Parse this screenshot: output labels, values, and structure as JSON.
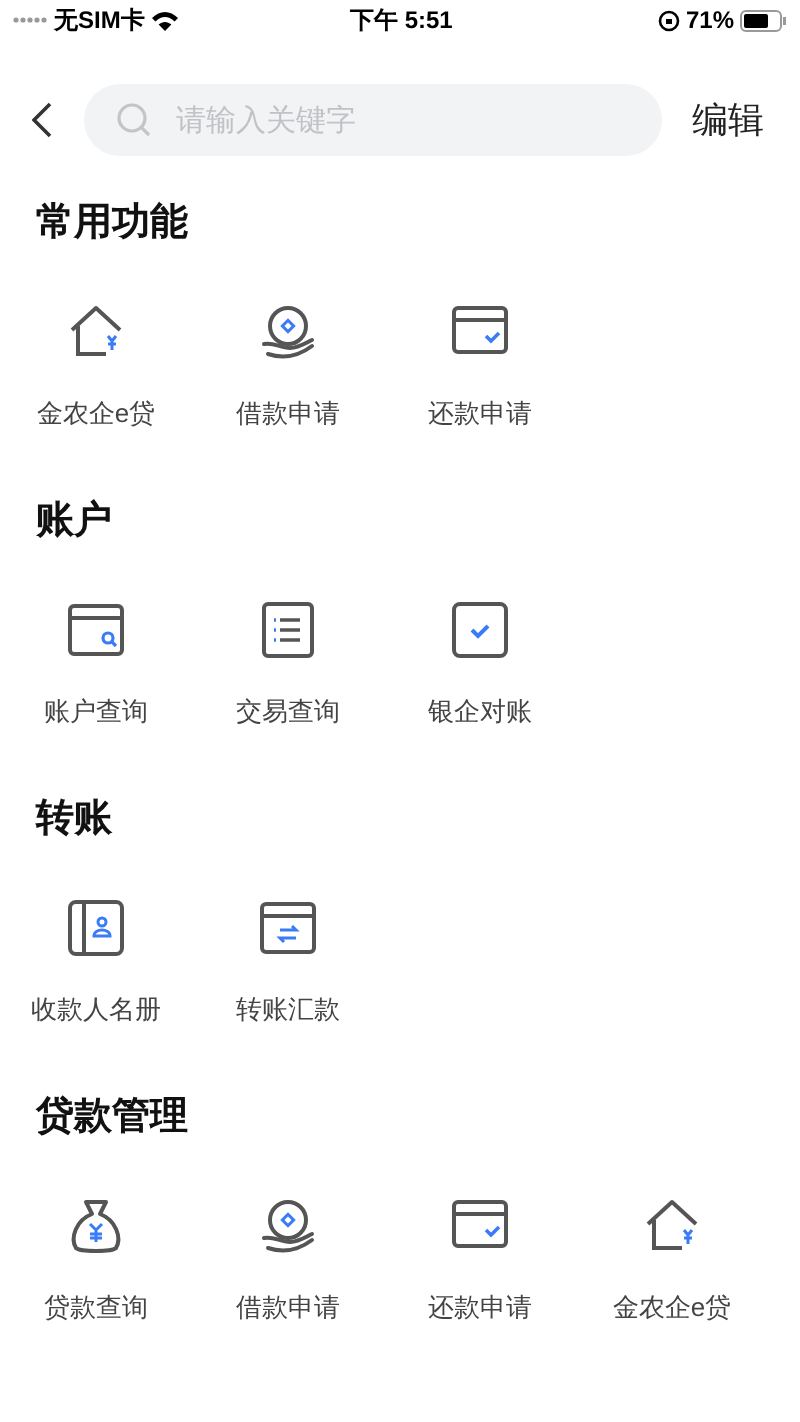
{
  "status_bar": {
    "carrier": "无SIM卡",
    "time": "下午 5:51",
    "battery": "71%"
  },
  "search": {
    "placeholder": "请输入关键字"
  },
  "edit_button": "编辑",
  "sections": [
    {
      "title": "常用功能",
      "items": [
        {
          "label": "金农企e贷",
          "kind": "house"
        },
        {
          "label": "借款申请",
          "kind": "hand"
        },
        {
          "label": "还款申请",
          "kind": "card_check"
        }
      ]
    },
    {
      "title": "账户",
      "items": [
        {
          "label": "账户查询",
          "kind": "card_search"
        },
        {
          "label": "交易查询",
          "kind": "list"
        },
        {
          "label": "银企对账",
          "kind": "check"
        }
      ]
    },
    {
      "title": "转账",
      "items": [
        {
          "label": "收款人名册",
          "kind": "book"
        },
        {
          "label": "转账汇款",
          "kind": "card_transfer"
        }
      ]
    },
    {
      "title": "贷款管理",
      "items": [
        {
          "label": "贷款查询",
          "kind": "bag"
        },
        {
          "label": "借款申请",
          "kind": "hand"
        },
        {
          "label": "还款申请",
          "kind": "card_check"
        },
        {
          "label": "金农企e贷",
          "kind": "house"
        }
      ]
    }
  ]
}
